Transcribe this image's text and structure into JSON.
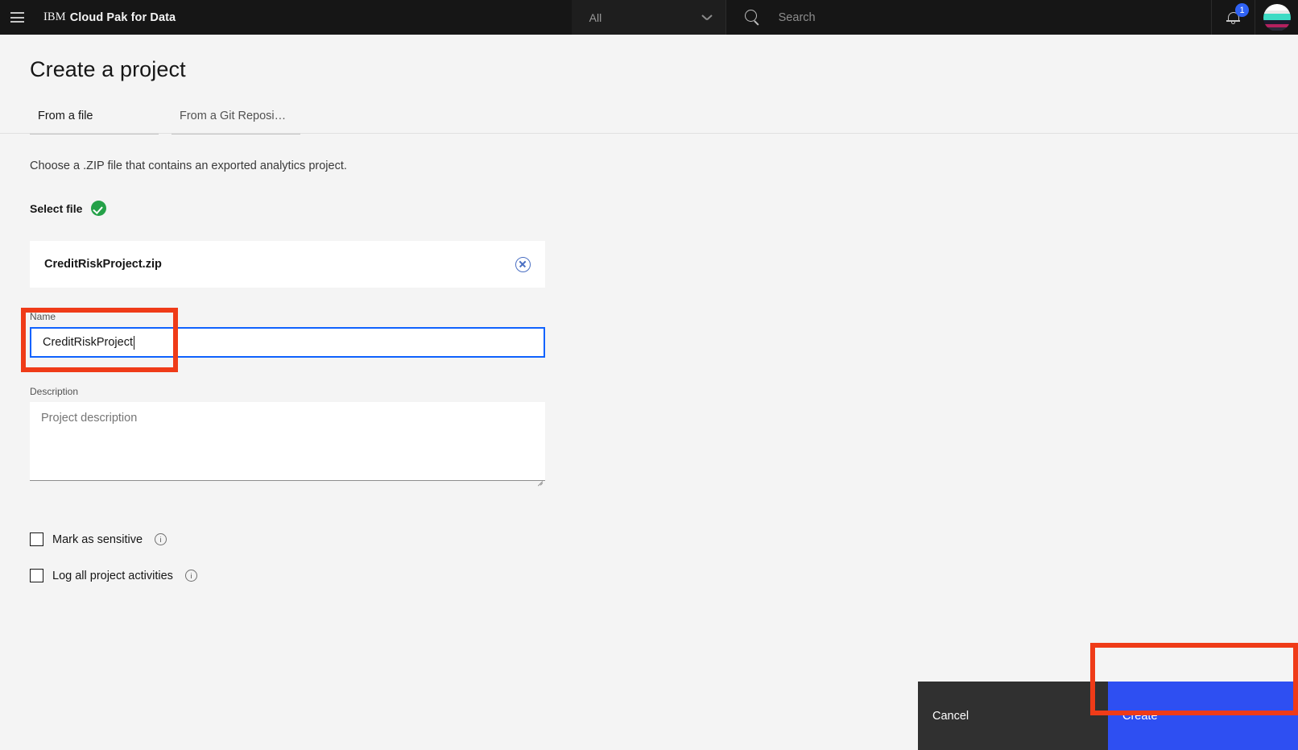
{
  "header": {
    "menu_icon": "hamburger-menu-icon",
    "brand_prefix": "IBM",
    "brand_name": "Cloud Pak for Data",
    "scope_value": "All",
    "scope_chevron_icon": "chevron-down-icon",
    "search_icon": "search-icon",
    "search_placeholder": "Search",
    "search_value": "",
    "bell_icon": "notification-bell-icon",
    "notification_count": "1",
    "avatar_icon": "user-avatar",
    "bg_color": "#161616",
    "badge_color": "#2f62f4"
  },
  "page": {
    "title": "Create a project"
  },
  "tabs": [
    {
      "label": "From a file",
      "active": true
    },
    {
      "label": "From a Git Reposi…",
      "active": false
    }
  ],
  "form": {
    "helper_text": "Choose a .ZIP file that contains an exported analytics project.",
    "select_file_label": "Select file",
    "select_file_status_icon": "green-check-circle-icon",
    "select_file_status_color": "#24a148",
    "file": {
      "name": "CreditRiskProject.zip",
      "remove_icon": "close-circle-icon",
      "remove_icon_color": "#4a6fc3"
    },
    "name_field": {
      "label": "Name",
      "value": "CreditRiskProject",
      "focused": true,
      "focus_border_color": "#0f62fe"
    },
    "description_field": {
      "label": "Description",
      "placeholder": "Project description",
      "value": ""
    },
    "checkboxes": [
      {
        "label": "Mark as sensitive",
        "checked": false,
        "info_icon": "info-circle-icon"
      },
      {
        "label": "Log all project activities",
        "checked": false,
        "info_icon": "info-circle-icon"
      }
    ]
  },
  "actions": {
    "cancel_label": "Cancel",
    "cancel_color": "#303030",
    "create_label": "Create",
    "create_color": "#2e4ff2"
  },
  "annotations": {
    "color": "#ef3b18",
    "targets": [
      "name-field",
      "create-button"
    ]
  }
}
